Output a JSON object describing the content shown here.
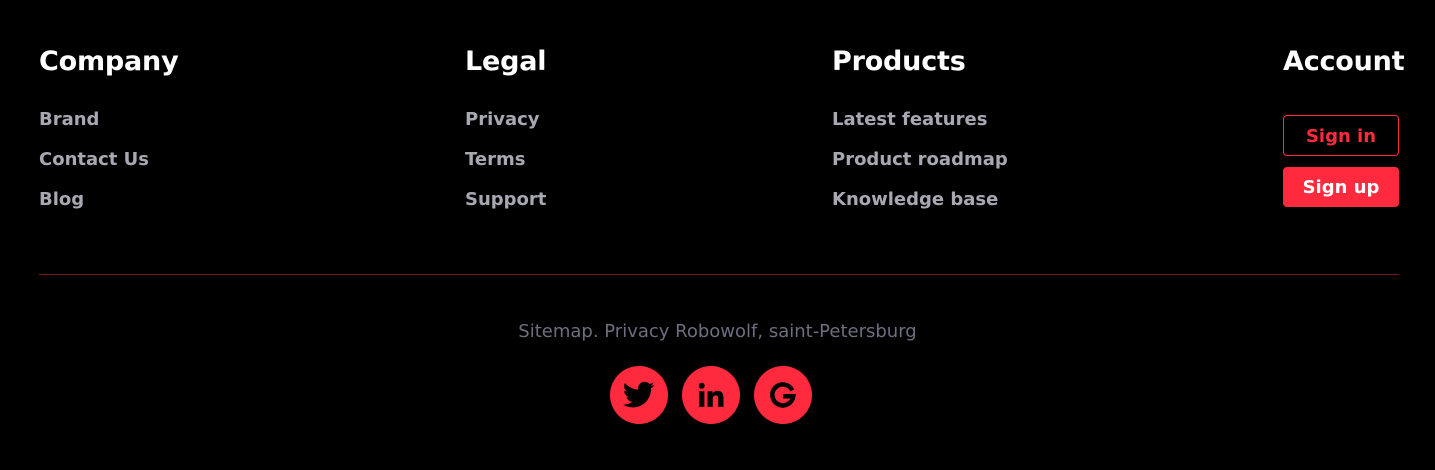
{
  "columns": {
    "company": {
      "title": "Company",
      "links": [
        "Brand",
        "Contact Us",
        "Blog"
      ]
    },
    "legal": {
      "title": "Legal",
      "links": [
        "Privacy",
        "Terms",
        "Support"
      ]
    },
    "products": {
      "title": "Products",
      "links": [
        "Latest features",
        "Product roadmap",
        "Knowledge base"
      ]
    },
    "account": {
      "title": "Account",
      "sign_in_label": "Sign in",
      "sign_up_label": "Sign up"
    }
  },
  "copyright": "Sitemap. Privacy Robowolf, saint-Petersburg",
  "socials": [
    {
      "icon": "twitter-icon"
    },
    {
      "icon": "linkedin-icon"
    },
    {
      "icon": "google-icon"
    }
  ],
  "colors": {
    "background": "#000000",
    "accent": "#ff2a3d",
    "heading": "#ffffff",
    "link": "#a8a8b3",
    "muted": "#6e6e80",
    "divider": "#7a1a1f"
  }
}
